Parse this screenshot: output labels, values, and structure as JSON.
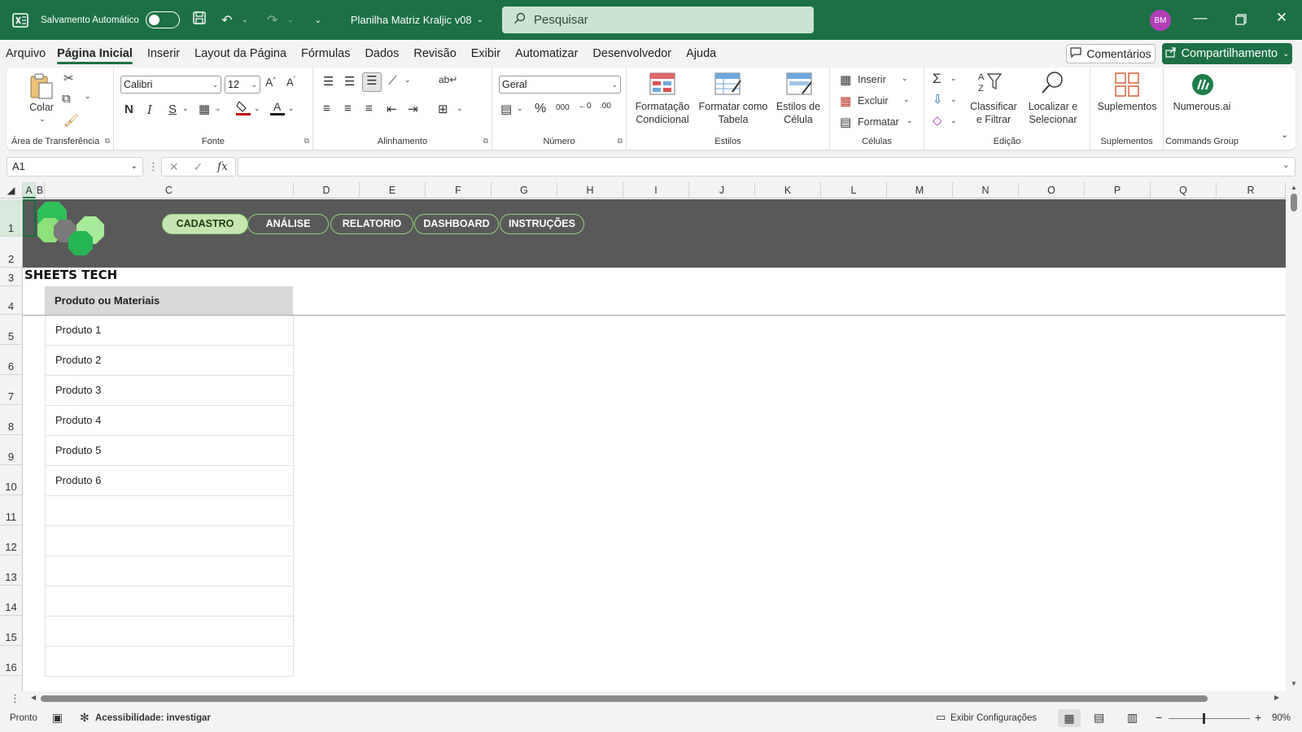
{
  "titlebar": {
    "autosave_label": "Salvamento Automático",
    "autosave_state": "off",
    "file_title": "Planilha Matriz Kraljic v08",
    "search_placeholder": "Pesquisar",
    "avatar_initials": "BM",
    "brand_color": "#1d7044",
    "avatar_color": "#b23fb8"
  },
  "menu": {
    "tabs": [
      "Arquivo",
      "Página Inicial",
      "Inserir",
      "Layout da Página",
      "Fórmulas",
      "Dados",
      "Revisão",
      "Exibir",
      "Automatizar",
      "Desenvolvedor",
      "Ajuda"
    ],
    "active_tab": "Página Inicial",
    "comments_label": "Comentários",
    "share_label": "Compartilhamento"
  },
  "ribbon": {
    "clipboard": {
      "paste_label": "Colar",
      "group_label": "Área de Transferência"
    },
    "font": {
      "name": "Calibri",
      "size": "12",
      "bold": "N",
      "italic": "I",
      "underline": "S",
      "group_label": "Fonte"
    },
    "alignment": {
      "group_label": "Alinhamento"
    },
    "number": {
      "format": "Geral",
      "group_label": "Número"
    },
    "styles": {
      "conditional": "Formatação Condicional",
      "as_table": "Formatar como Tabela",
      "cell_styles": "Estilos de Célula",
      "group_label": "Estilos"
    },
    "cells": {
      "insert": "Inserir",
      "delete": "Excluir",
      "format": "Formatar",
      "group_label": "Células"
    },
    "editing": {
      "sort": "Classificar e Filtrar",
      "find": "Localizar e Selecionar",
      "group_label": "Edição"
    },
    "addins": {
      "addins": "Suplementos",
      "group_label": "Suplementos"
    },
    "commands": {
      "numerous": "Numerous.ai",
      "group_label": "Commands Group"
    }
  },
  "formula_bar": {
    "name_box": "A1",
    "formula": ""
  },
  "grid": {
    "columns": [
      "A",
      "B",
      "C",
      "D",
      "E",
      "F",
      "G",
      "H",
      "I",
      "J",
      "K",
      "L",
      "M",
      "N",
      "O",
      "P",
      "Q",
      "R"
    ],
    "rows": [
      "1",
      "2",
      "3",
      "4",
      "5",
      "6",
      "7",
      "8",
      "9",
      "10",
      "11",
      "12",
      "13",
      "14",
      "15",
      "16"
    ]
  },
  "sheet": {
    "nav_buttons": [
      "CADASTRO",
      "ANÁLISE",
      "RELATORIO",
      "DASHBOARD",
      "INSTRUÇÕES"
    ],
    "active_nav": "CADASTRO",
    "brand_text": "SHEETS TECH",
    "table_header": "Produto ou Materiais",
    "products": [
      "Produto 1",
      "Produto 2",
      "Produto 3",
      "Produto 4",
      "Produto 5",
      "Produto 6"
    ],
    "banner_color": "#595959",
    "nav_accent_color": "#8fd17a"
  },
  "status": {
    "ready": "Pronto",
    "accessibility": "Acessibilidade: investigar",
    "display_settings": "Exibir Configurações",
    "zoom": "90%"
  }
}
